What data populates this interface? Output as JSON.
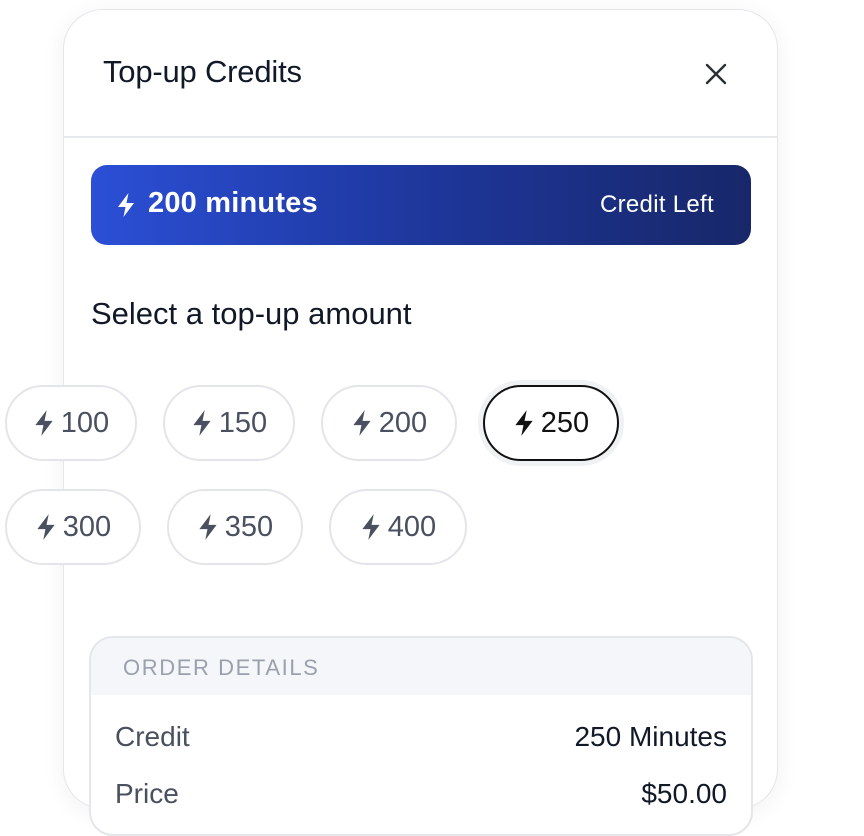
{
  "dialog": {
    "title": "Top-up Credits",
    "close_icon": "close-icon"
  },
  "balance": {
    "icon": "bolt-icon",
    "amount": "200 minutes",
    "caption": "Credit Left",
    "gradient_colors": [
      "#2b4fd6",
      "#182769"
    ]
  },
  "topup": {
    "heading": "Select a top-up amount",
    "options": [
      "100",
      "150",
      "200",
      "250",
      "300",
      "350",
      "400"
    ],
    "selected": "250"
  },
  "order": {
    "title": "ORDER DETAILS",
    "rows": [
      {
        "label": "Credit",
        "value": "250 Minutes"
      },
      {
        "label": "Price",
        "value": "$50.00"
      }
    ]
  }
}
